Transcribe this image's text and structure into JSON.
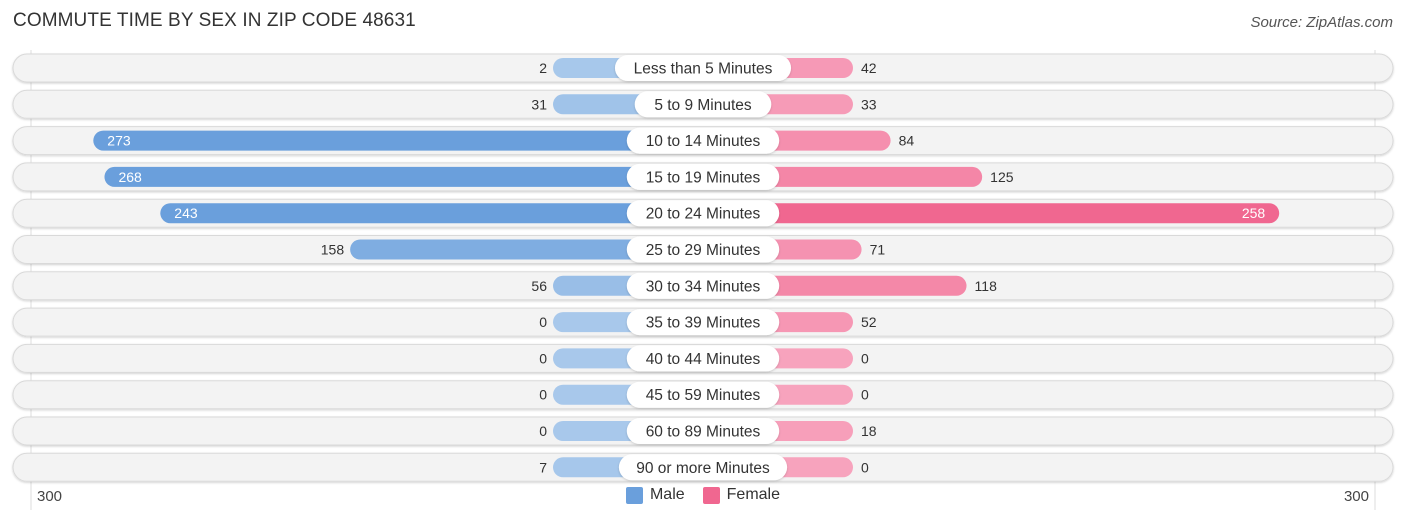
{
  "title": "COMMUTE TIME BY SEX IN ZIP CODE 48631",
  "source": "Source: ZipAtlas.com",
  "colors": {
    "male": "#6a9fdc",
    "male_light": "#a8c8eb",
    "female": "#f06790",
    "female_light": "#f7a3bd",
    "track": "#f3f3f3",
    "track_border": "#d9d9d9"
  },
  "legend": [
    {
      "label": "Male",
      "color": "#6a9fdc"
    },
    {
      "label": "Female",
      "color": "#f06790"
    }
  ],
  "axis": {
    "left_label": "300",
    "right_label": "300"
  },
  "chart_data": {
    "type": "bar",
    "orientation": "horizontal-diverging",
    "title": "COMMUTE TIME BY SEX IN ZIP CODE 48631",
    "categories": [
      "Less than 5 Minutes",
      "5 to 9 Minutes",
      "10 to 14 Minutes",
      "15 to 19 Minutes",
      "20 to 24 Minutes",
      "25 to 29 Minutes",
      "30 to 34 Minutes",
      "35 to 39 Minutes",
      "40 to 44 Minutes",
      "45 to 59 Minutes",
      "60 to 89 Minutes",
      "90 or more Minutes"
    ],
    "series": [
      {
        "name": "Male",
        "values": [
          2,
          31,
          273,
          268,
          243,
          158,
          56,
          0,
          0,
          0,
          0,
          7
        ]
      },
      {
        "name": "Female",
        "values": [
          42,
          33,
          84,
          125,
          258,
          71,
          118,
          52,
          0,
          0,
          18,
          0
        ]
      }
    ],
    "xlim": [
      -300,
      300
    ],
    "xlabel": "",
    "ylabel": "",
    "legend_position": "bottom-center",
    "grid": false
  }
}
